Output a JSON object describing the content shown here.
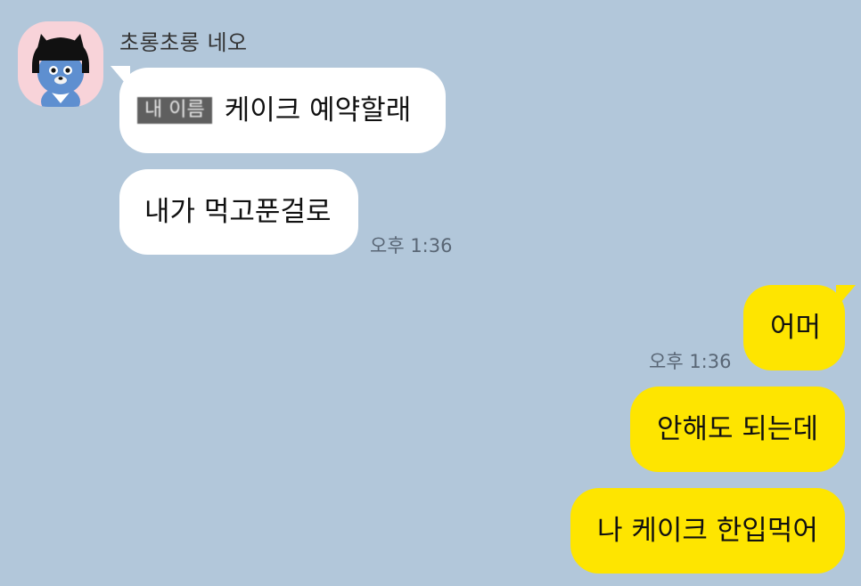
{
  "sender": {
    "name": "초롱초롱 네오"
  },
  "messages_in": [
    {
      "masked_name": "내 이름",
      "text": "케이크 예약할래"
    },
    {
      "text": "내가 먹고푼걸로",
      "time": "오후 1:36"
    }
  ],
  "messages_out": [
    {
      "text": "어머",
      "time": "오후 1:36"
    },
    {
      "text": "안해도 되는데"
    },
    {
      "text": "나 케이크 한입먹어"
    }
  ],
  "colors": {
    "background": "#b2c7da",
    "incoming_bubble": "#ffffff",
    "outgoing_bubble": "#fee500",
    "avatar_bg": "#f8d3d9"
  },
  "icons": {
    "avatar": "neo-character-avatar"
  }
}
